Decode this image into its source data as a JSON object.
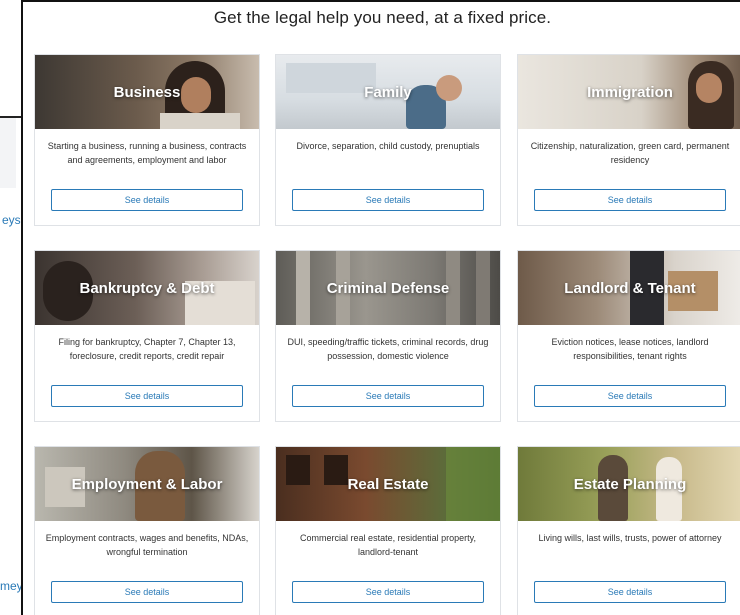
{
  "background": {
    "partial_text_1": "eys",
    "partial_text_2": "mey"
  },
  "modal": {
    "title": "Get the legal help you need, at a fixed price."
  },
  "categories": [
    {
      "label": "Business",
      "description": "Starting a business, running a business, contracts and agreements, employment and labor",
      "button": "See details"
    },
    {
      "label": "Family",
      "description": "Divorce, separation, child custody, prenuptials",
      "button": "See details"
    },
    {
      "label": "Immigration",
      "description": "Citizenship, naturalization, green card, permanent residency",
      "button": "See details"
    },
    {
      "label": "Bankruptcy & Debt",
      "description": "Filing for bankruptcy, Chapter 7, Chapter 13, foreclosure, credit reports, credit repair",
      "button": "See details"
    },
    {
      "label": "Criminal Defense",
      "description": "DUI, speeding/traffic tickets, criminal records, drug possession, domestic violence",
      "button": "See details"
    },
    {
      "label": "Landlord & Tenant",
      "description": "Eviction notices, lease notices, landlord responsibilities, tenant rights",
      "button": "See details"
    },
    {
      "label": "Employment & Labor",
      "description": "Employment contracts, wages and benefits, NDAs, wrongful termination",
      "button": "See details"
    },
    {
      "label": "Real Estate",
      "description": "Commercial real estate, residential property, landlord-tenant",
      "button": "See details"
    },
    {
      "label": "Estate Planning",
      "description": "Living wills, last wills, trusts, power of attorney",
      "button": "See details"
    }
  ],
  "colors": {
    "accent": "#2a7ab7",
    "card_border": "#dfe2e6"
  }
}
